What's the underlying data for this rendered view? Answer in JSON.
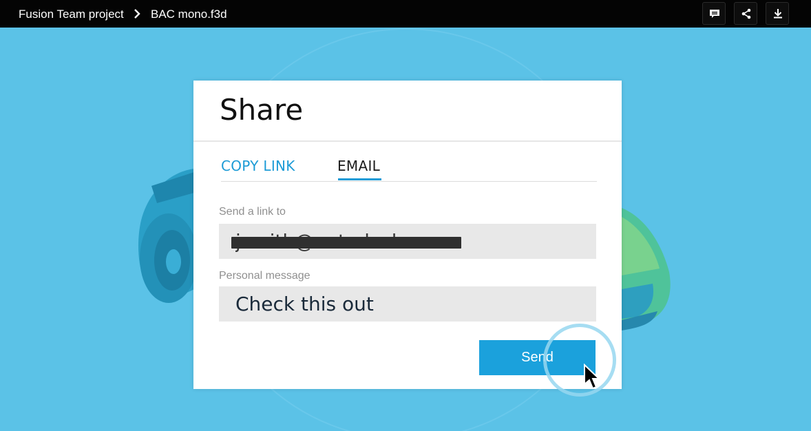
{
  "breadcrumb": {
    "project": "Fusion Team project",
    "file": "BAC mono.f3d"
  },
  "toolbar": {
    "comment_icon": "comment-icon",
    "share_icon": "share-icon",
    "download_icon": "download-icon"
  },
  "dialog": {
    "title": "Share",
    "tabs": [
      {
        "label": "COPY LINK",
        "active": false
      },
      {
        "label": "EMAIL",
        "active": true
      }
    ],
    "send_link_label": "Send a link to",
    "email_value": "jsmith@autodesk.com",
    "personal_message_label": "Personal message",
    "personal_message_value": "Check this out",
    "send_label": "Send"
  },
  "colors": {
    "background": "#5bc2e7",
    "accent": "#1ba1dc",
    "topbar": "#040404"
  }
}
